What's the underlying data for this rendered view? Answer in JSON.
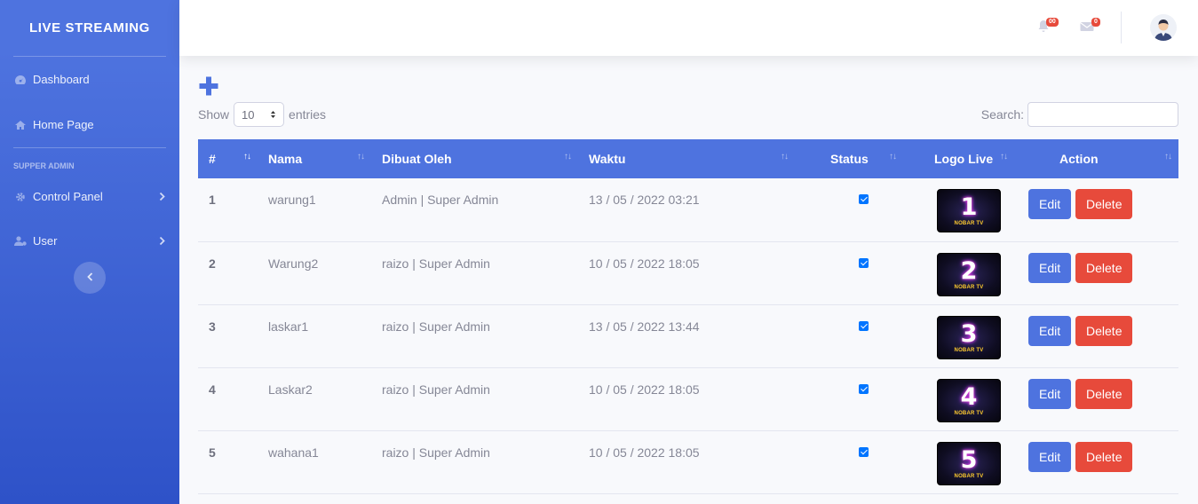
{
  "sidebar": {
    "brand": "LIVE STREAMING",
    "items": [
      {
        "label": "Dashboard"
      },
      {
        "label": "Home Page"
      }
    ],
    "heading": "SUPPER ADMIN",
    "groups": [
      {
        "label": "Control Panel"
      },
      {
        "label": "User"
      }
    ]
  },
  "topbar": {
    "alerts_badge": "00",
    "messages_badge": "0"
  },
  "table_controls": {
    "show_label": "Show",
    "entries_value": "10",
    "entries_label": "entries",
    "search_label": "Search:",
    "search_value": ""
  },
  "table": {
    "headers": [
      "#",
      "Nama",
      "Dibuat Oleh",
      "Waktu",
      "Status",
      "Logo Live",
      "Action"
    ],
    "rows": [
      {
        "num": "1",
        "nama": "warung1",
        "by": "Admin | Super Admin",
        "time": "13 / 05 / 2022 03:21",
        "status": true,
        "logo_number": "1",
        "logo_text": "NOBAR TV"
      },
      {
        "num": "2",
        "nama": "Warung2",
        "by": "raizo | Super Admin",
        "time": "10 / 05 / 2022 18:05",
        "status": true,
        "logo_number": "2",
        "logo_text": "NOBAR TV"
      },
      {
        "num": "3",
        "nama": "laskar1",
        "by": "raizo | Super Admin",
        "time": "13 / 05 / 2022 13:44",
        "status": true,
        "logo_number": "3",
        "logo_text": "NOBAR TV"
      },
      {
        "num": "4",
        "nama": "Laskar2",
        "by": "raizo | Super Admin",
        "time": "10 / 05 / 2022 18:05",
        "status": true,
        "logo_number": "4",
        "logo_text": "NOBAR TV"
      },
      {
        "num": "5",
        "nama": "wahana1",
        "by": "raizo | Super Admin",
        "time": "10 / 05 / 2022 18:05",
        "status": true,
        "logo_number": "5",
        "logo_text": "NOBAR TV"
      }
    ],
    "edit_label": "Edit",
    "delete_label": "Delete"
  },
  "colors": {
    "primary": "#4e73df",
    "danger": "#e74a3b",
    "text": "#858796"
  }
}
